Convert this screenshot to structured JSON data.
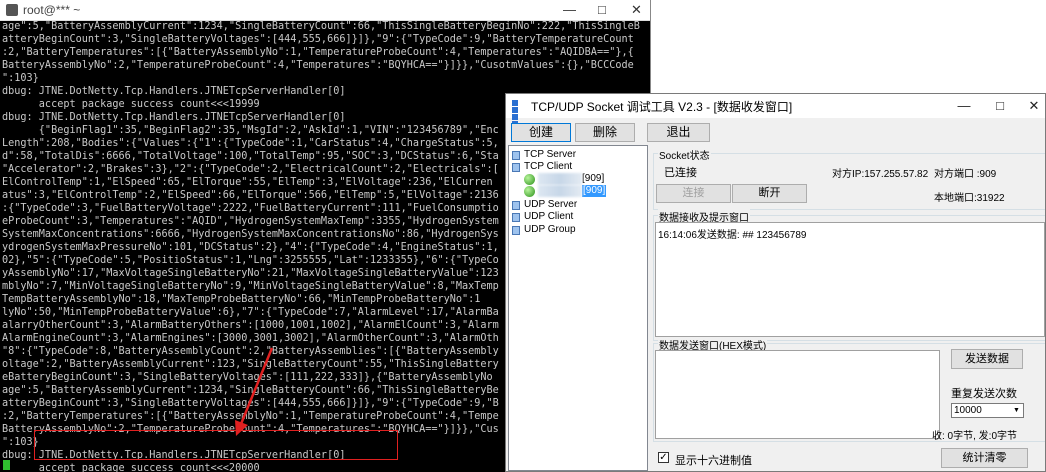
{
  "terminal": {
    "title": "root@*** ~",
    "lines": [
      "age\":5,\"BatteryAssemblyCurrent\":1234,\"SingleBatteryCount\":66,\"ThisSingleBatteryBeginNo\":222,\"ThisSingleB",
      "atteryBeginCount\":3,\"SingleBatteryVoltages\":[444,555,666]}]},\"9\":{\"TypeCode\":9,\"BatteryTemperatureCount",
      ":2,\"BatteryTemperatures\":[{\"BatteryAssemblyNo\":1,\"TemperatureProbeCount\":4,\"Temperatures\":\"AQIDBA==\"},{",
      "BatteryAssemblyNo\":2,\"TemperatureProbeCount\":4,\"Temperatures\":\"BQYHCA==\"}]}},\"CusotmValues\":{},\"BCCCode",
      "\":103}",
      "dbug: JTNE.DotNetty.Tcp.Handlers.JTNETcpServerHandler[0]",
      "      accept package success count<<<19999",
      "dbug: JTNE.DotNetty.Tcp.Handlers.JTNETcpServerHandler[0]",
      "      {\"BeginFlag1\":35,\"BeginFlag2\":35,\"MsgId\":2,\"AskId\":1,\"VIN\":\"123456789\",\"Enc",
      "Length\":208,\"Bodies\":{\"Values\":{\"1\":{\"TypeCode\":1,\"CarStatus\":4,\"ChargeStatus\":5,",
      "d\":58,\"TotalDis\":6666,\"TotalVoltage\":100,\"TotalTemp\":95,\"SOC\":3,\"DCStatus\":6,\"Sta",
      "\"Accelerator\":2,\"Brakes\":3},\"2\":{\"TypeCode\":2,\"ElectricalCount\":2,\"Electricals\":[",
      "ElControlTemp\":1,\"ElSpeed\":65,\"ElTorque\":55,\"ElTemp\":3,\"ElVoltage\":236,\"ElCurren",
      "atus\":3,\"ElControlTemp\":2,\"ElSpeed\":66,\"ElTorque\":566,\"ElTemp\":5,\"ElVoltage\":2136",
      ":{\"TypeCode\":3,\"FuelBatteryVoltage\":2222,\"FuelBatteryCurrent\":111,\"FuelConsumptio",
      "eProbeCount\":3,\"Temperatures\":\"AQID\",\"HydrogenSystemMaxTemp\":3355,\"HydrogenSystem",
      "SystemMaxConcentrations\":6666,\"HydrogenSystemMaxConcentrationsNo\":86,\"HydrogenSys",
      "ydrogenSystemMaxPressureNo\":101,\"DCStatus\":2},\"4\":{\"TypeCode\":4,\"EngineStatus\":1,",
      "02},\"5\":{\"TypeCode\":5,\"PositioStatus\":1,\"Lng\":3255555,\"Lat\":1233355},\"6\":{\"TypeCo",
      "yAssemblyNo\":17,\"MaxVoltageSingleBatteryNo\":21,\"MaxVoltageSingleBatteryValue\":123",
      "mblyNo\":7,\"MinVoltageSingleBatteryNo\":9,\"MinVoltageSingleBatteryValue\":8,\"MaxTemp",
      "TempBatteryAssemblyNo\":18,\"MaxTempProbeBatteryNo\":66,\"MinTempProbeBatteryNo\":1",
      "lyNo\":50,\"MinTempProbeBatteryValue\":6},\"7\":{\"TypeCode\":7,\"AlarmLevel\":17,\"AlarmBa",
      "alarryOtherCount\":3,\"AlarmBatteryOthers\":[1000,1001,1002],\"AlarmElCount\":3,\"Alarm",
      "AlarmEngineCount\":3,\"AlarmEngines\":[3000,3001,3002],\"AlarmOtherCount\":3,\"AlarmOth",
      "\"8\":{\"TypeCode\":8,\"BatteryAssemblyCount\":2,\"BatteryAssemblies\":[{\"BatteryAssembly",
      "oltage\":2,\"BatteryAssemblyCurrent\":123,\"SingleBatteryCount\":55,\"ThisSingleBattery",
      "eBatteryBeginCount\":3,\"SingleBatteryVoltages\":[111,222,333]},{\"BatteryAssemblyNo",
      "age\":5,\"BatteryAssemblyCurrent\":1234,\"SingleBatteryCount\":66,\"ThisSingleBatteryBe",
      "atteryBeginCount\":3,\"SingleBatteryVoltages\":[444,555,666]}]},\"9\":{\"TypeCode\":9,\"B",
      ":2,\"BatteryTemperatures\":[{\"BatteryAssemblyNo\":1,\"TemperatureProbeCount\":4,\"Tempe",
      "BatteryAssemblyNo\":2,\"TemperatureProbeCount\":4,\"Temperatures\":\"BQYHCA==\"}]}},\"Cus",
      "\":103}",
      "dbug: JTNE.DotNetty.Tcp.Handlers.JTNETcpServerHandler[0]",
      "      accept package success count<<<20000"
    ]
  },
  "tool": {
    "title": "TCP/UDP Socket 调试工具 V2.3 - [数据收发窗口]",
    "toolbar": {
      "create": "创建",
      "delete": "删除",
      "exit": "退出"
    },
    "tree": {
      "tcp_server": "TCP Server",
      "tcp_client": "TCP Client",
      "client1_port": "[909]",
      "client2_port": "[909]",
      "udp_server": "UDP Server",
      "udp_client": "UDP Client",
      "udp_group": "UDP Group"
    },
    "socket_status": {
      "group_label": "Socket状态",
      "connected": "已连接",
      "remote_ip": "对方IP:157.255.57.82",
      "remote_port": "对方端口 :909",
      "local_port": "本地端口:31922",
      "connect_btn": "连接",
      "disconnect_btn": "断开"
    },
    "recv": {
      "group_label": "数据接收及提示窗口",
      "content": "16:14:06发送数据: ## 123456789"
    },
    "send": {
      "group_label": "数据发送窗口(HEX模式)",
      "send_btn": "发送数据",
      "repeat_label": "重复发送次数",
      "repeat_value": "10000",
      "stats": "收: 0字节, 发:0字节"
    },
    "bottom": {
      "hex_label": "显示十六进制值",
      "clear_btn": "统计清零"
    },
    "colors": {
      "selection": "#3399ff",
      "arrow": "#e02020",
      "terminal_bg": "#000000"
    }
  }
}
